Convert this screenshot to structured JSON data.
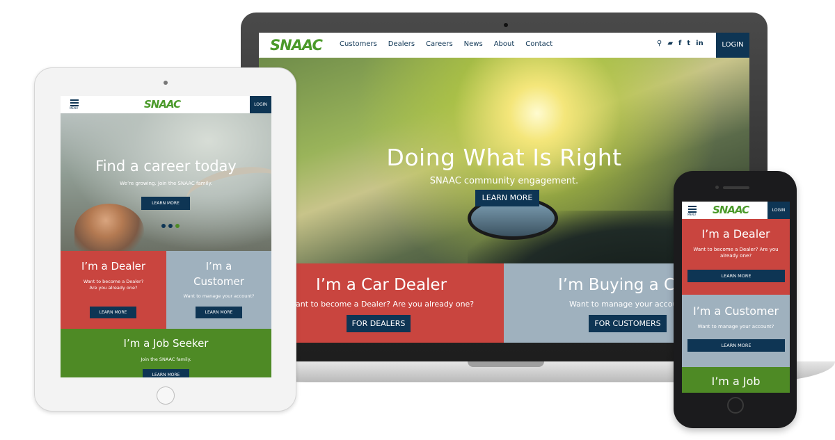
{
  "brand": {
    "logo_text": "SNAAC",
    "green": "#4e8a25",
    "navy": "#0e3554",
    "red": "#c9453f",
    "gray": "#9fb1be"
  },
  "laptop": {
    "nav": [
      "Customers",
      "Dealers",
      "Careers",
      "News",
      "About",
      "Contact"
    ],
    "social_icons": [
      "search-icon",
      "chat-icon",
      "facebook-icon",
      "twitter-icon",
      "linkedin-icon"
    ],
    "social_glyphs": [
      "⚲",
      "▰",
      "f",
      "t",
      "in"
    ],
    "login": "LOGIN",
    "hero": {
      "title": "Doing What Is Right",
      "subtitle": "SNAAC community engagement.",
      "button": "LEARN MORE"
    },
    "tiles": [
      {
        "title": "I’m a Car Dealer",
        "text": "Want to become a Dealer? Are you already one?",
        "button": "FOR DEALERS"
      },
      {
        "title": "I’m Buying a C",
        "text": "Want to manage your accou",
        "button": "FOR CUSTOMERS"
      }
    ]
  },
  "tablet": {
    "menu_label": "MENU",
    "login": "LOGIN",
    "hero": {
      "title": "Find a career today",
      "subtitle": "We’re growing. Join the SNAAC family.",
      "button": "LEARN MORE"
    },
    "tiles": [
      {
        "title": "I’m a Dealer",
        "text": "Want to become a Dealer? Are you already one?",
        "button": "LEARN MORE"
      },
      {
        "title_line1": "I’m a",
        "title_line2": "Customer",
        "text": "Want to manage your account?",
        "button": "LEARN MORE"
      },
      {
        "title": "I’m a Job Seeker",
        "text": "Join the SNAAC family.",
        "button": "LEARN MORE"
      }
    ]
  },
  "phone": {
    "menu_label": "MENU",
    "login": "LOGIN",
    "tiles": [
      {
        "title": "I’m a Dealer",
        "text": "Want to become a Dealer? Are you already one?",
        "button": "LEARN MORE"
      },
      {
        "title": "I’m a Customer",
        "text": "Want to manage your account?",
        "button": "LEARN MORE"
      },
      {
        "title": "I’m a Job"
      }
    ]
  }
}
